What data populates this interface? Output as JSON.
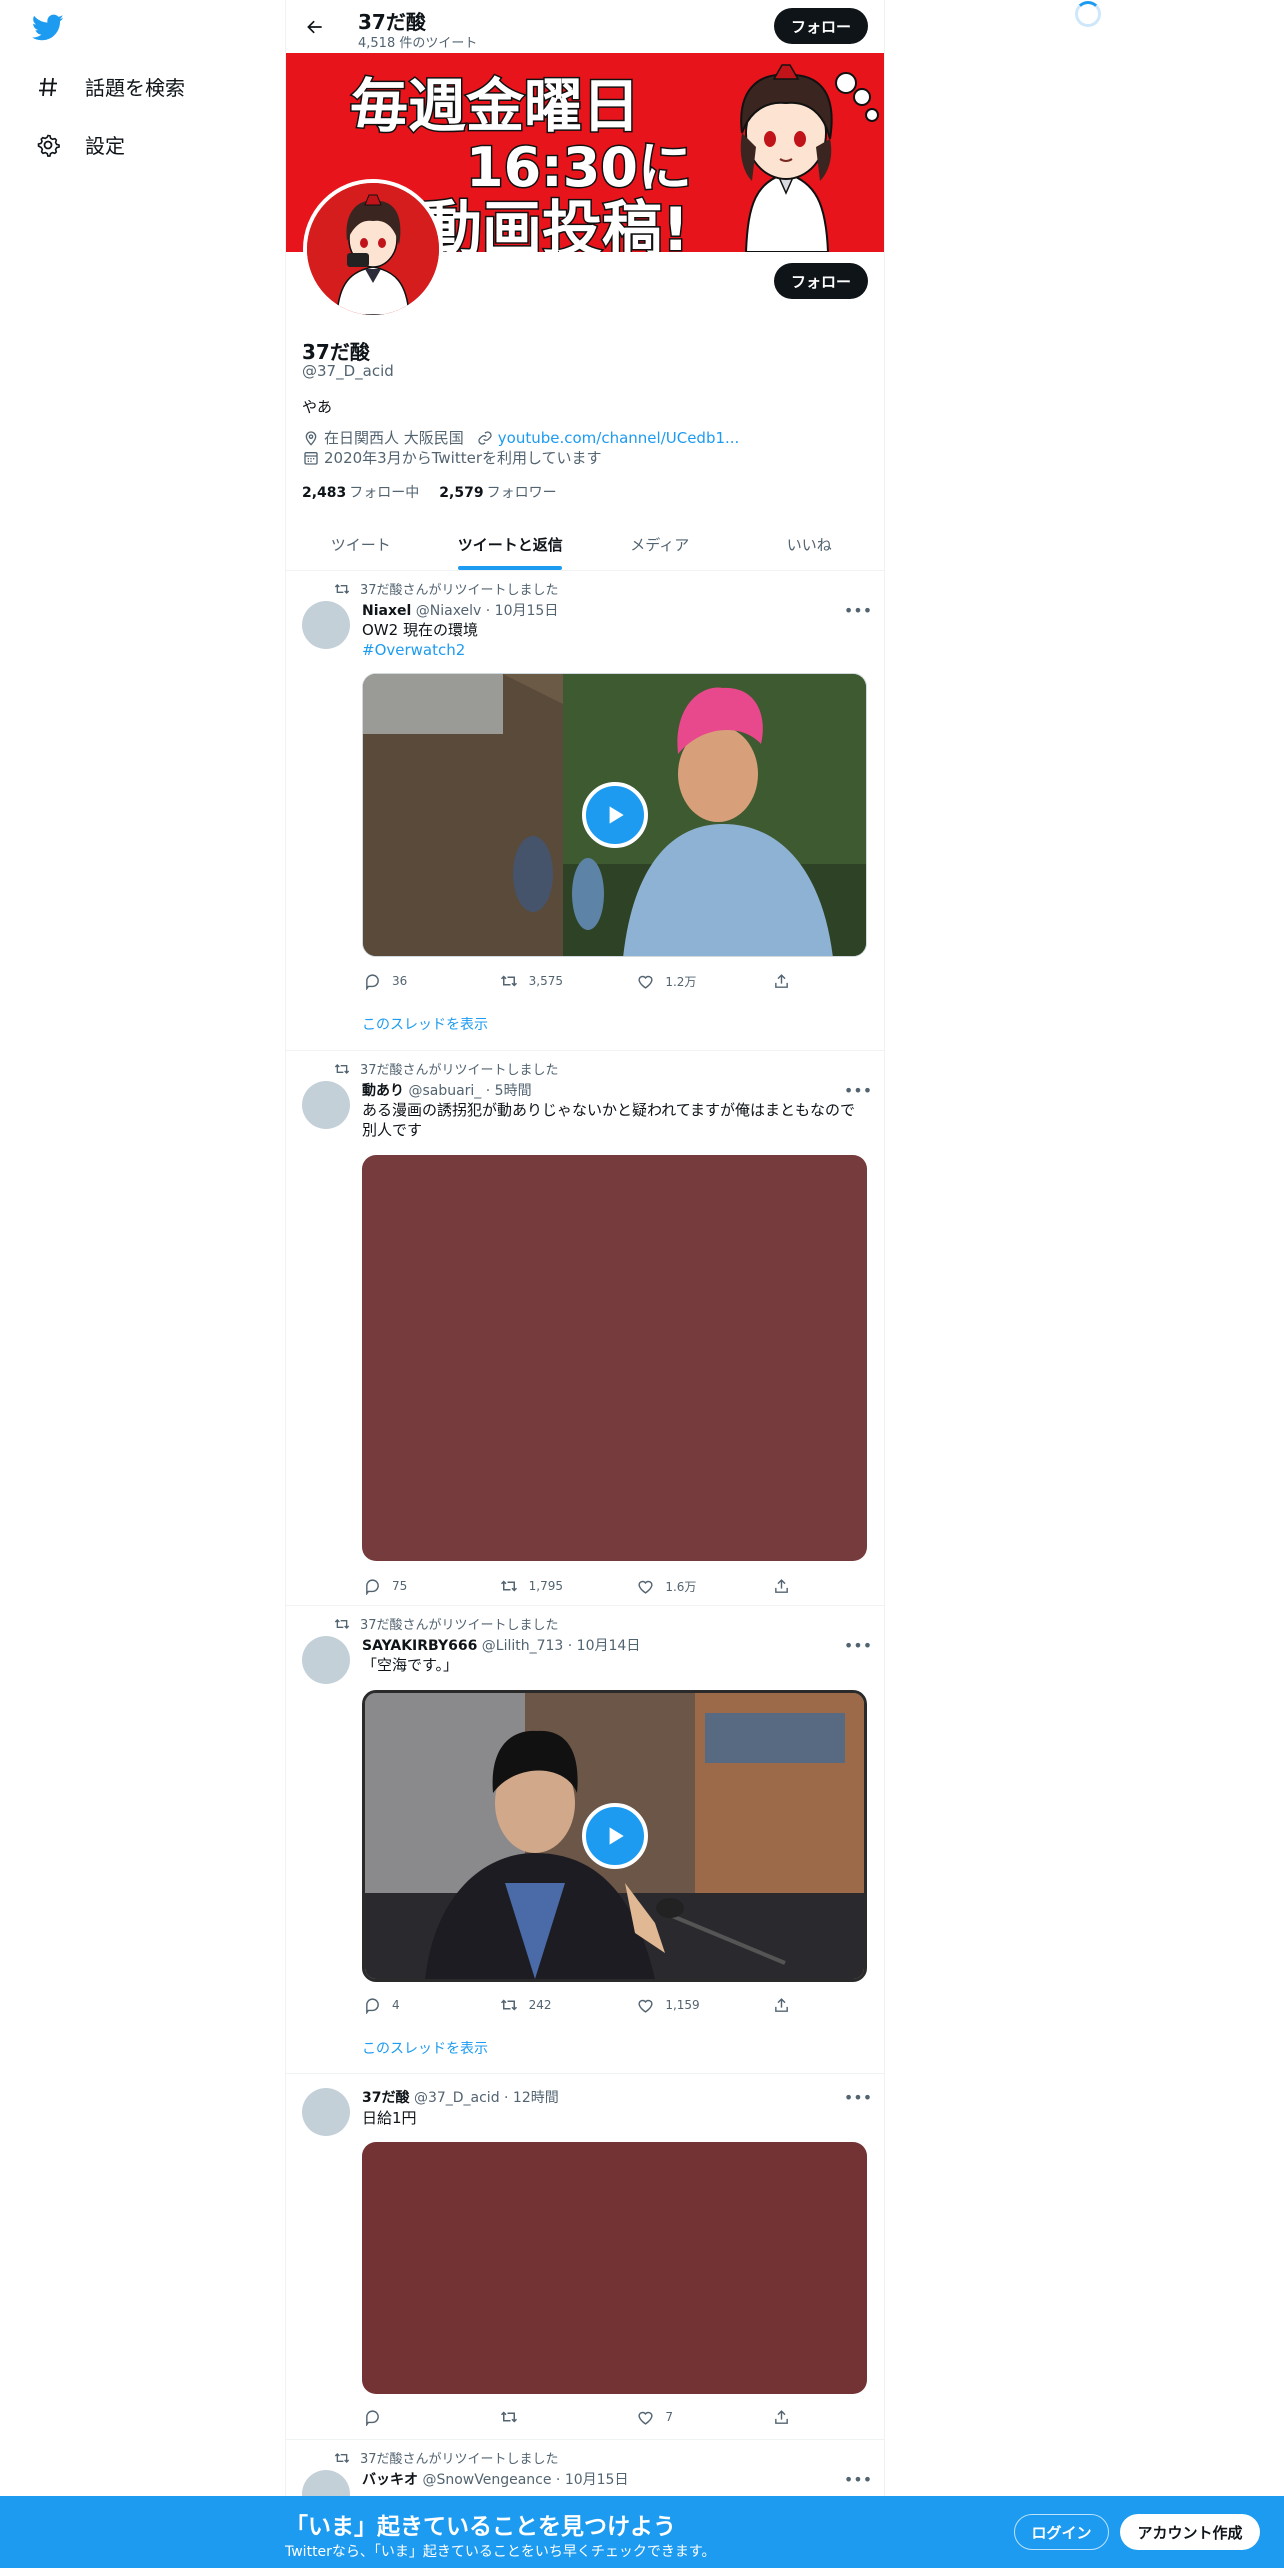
{
  "nav": {
    "items": [
      {
        "label": "話題を検索",
        "icon": "hashtag-icon"
      },
      {
        "label": "設定",
        "icon": "gear-icon"
      }
    ]
  },
  "header": {
    "name": "37だ酸",
    "tweet_count": "4,518 件のツイート",
    "follow_label": "フォロー"
  },
  "banner": {
    "line1": "毎週金曜日",
    "line2": "16:30に",
    "line3": "動画投稿!"
  },
  "profile": {
    "name": "37だ酸",
    "handle": "@37_D_acid",
    "bio": "やあ",
    "location": "在日関西人 大阪民国",
    "link": "youtube.com/channel/UCedb1...",
    "joined": "2020年3月からTwitterを利用しています",
    "following_count": "2,483",
    "following_label": "フォロー中",
    "followers_count": "2,579",
    "followers_label": "フォロワー",
    "follow_label": "フォロー"
  },
  "tabs": [
    {
      "label": "ツイート",
      "active": false
    },
    {
      "label": "ツイートと返信",
      "active": true
    },
    {
      "label": "メディア",
      "active": false
    },
    {
      "label": "いいね",
      "active": false
    }
  ],
  "tweets": [
    {
      "retweet_label": "37だ酸さんがリツイートしました",
      "name": "Niaxel",
      "handle_time": "@Niaxelv · 10月15日",
      "text": "OW2 現在の環境",
      "hashtag": "#Overwatch2",
      "replies": "36",
      "retweets": "3,575",
      "likes": "1.2万",
      "thread_link": "このスレッドを表示"
    },
    {
      "retweet_label": "37だ酸さんがリツイートしました",
      "name": "動あり",
      "handle_time": "@sabuari_ · 5時間",
      "text": "ある漫画の誘拐犯が動ありじゃないかと疑われてますが俺はまともなので別人です",
      "replies": "75",
      "retweets": "1,795",
      "likes": "1.6万",
      "media_color": "#763b3c"
    },
    {
      "retweet_label": "37だ酸さんがリツイートしました",
      "name": "SAYAKIRBY666",
      "handle_time": "@Lilith_713 · 10月14日",
      "text": "「空海です。」",
      "replies": "4",
      "retweets": "242",
      "likes": "1,159",
      "thread_link": "このスレッドを表示"
    },
    {
      "name": "37だ酸",
      "handle_time": "@37_D_acid · 12時間",
      "text": "日給1円",
      "replies": "",
      "retweets": "",
      "likes": "7",
      "media_color": "#733334"
    },
    {
      "retweet_label": "37だ酸さんがリツイートしました",
      "name": "バッキオ",
      "handle_time": "@SnowVengeance · 10月15日"
    }
  ],
  "bottom_bar": {
    "title": "「いま」起きていることを見つけよう",
    "subtitle": "Twitterなら、「いま」起きていることをいち早くチェックできます。",
    "login_label": "ログイン",
    "signup_label": "アカウント作成"
  },
  "colors": {
    "accent": "#1d9bf0",
    "banner_red": "#e8141c"
  }
}
